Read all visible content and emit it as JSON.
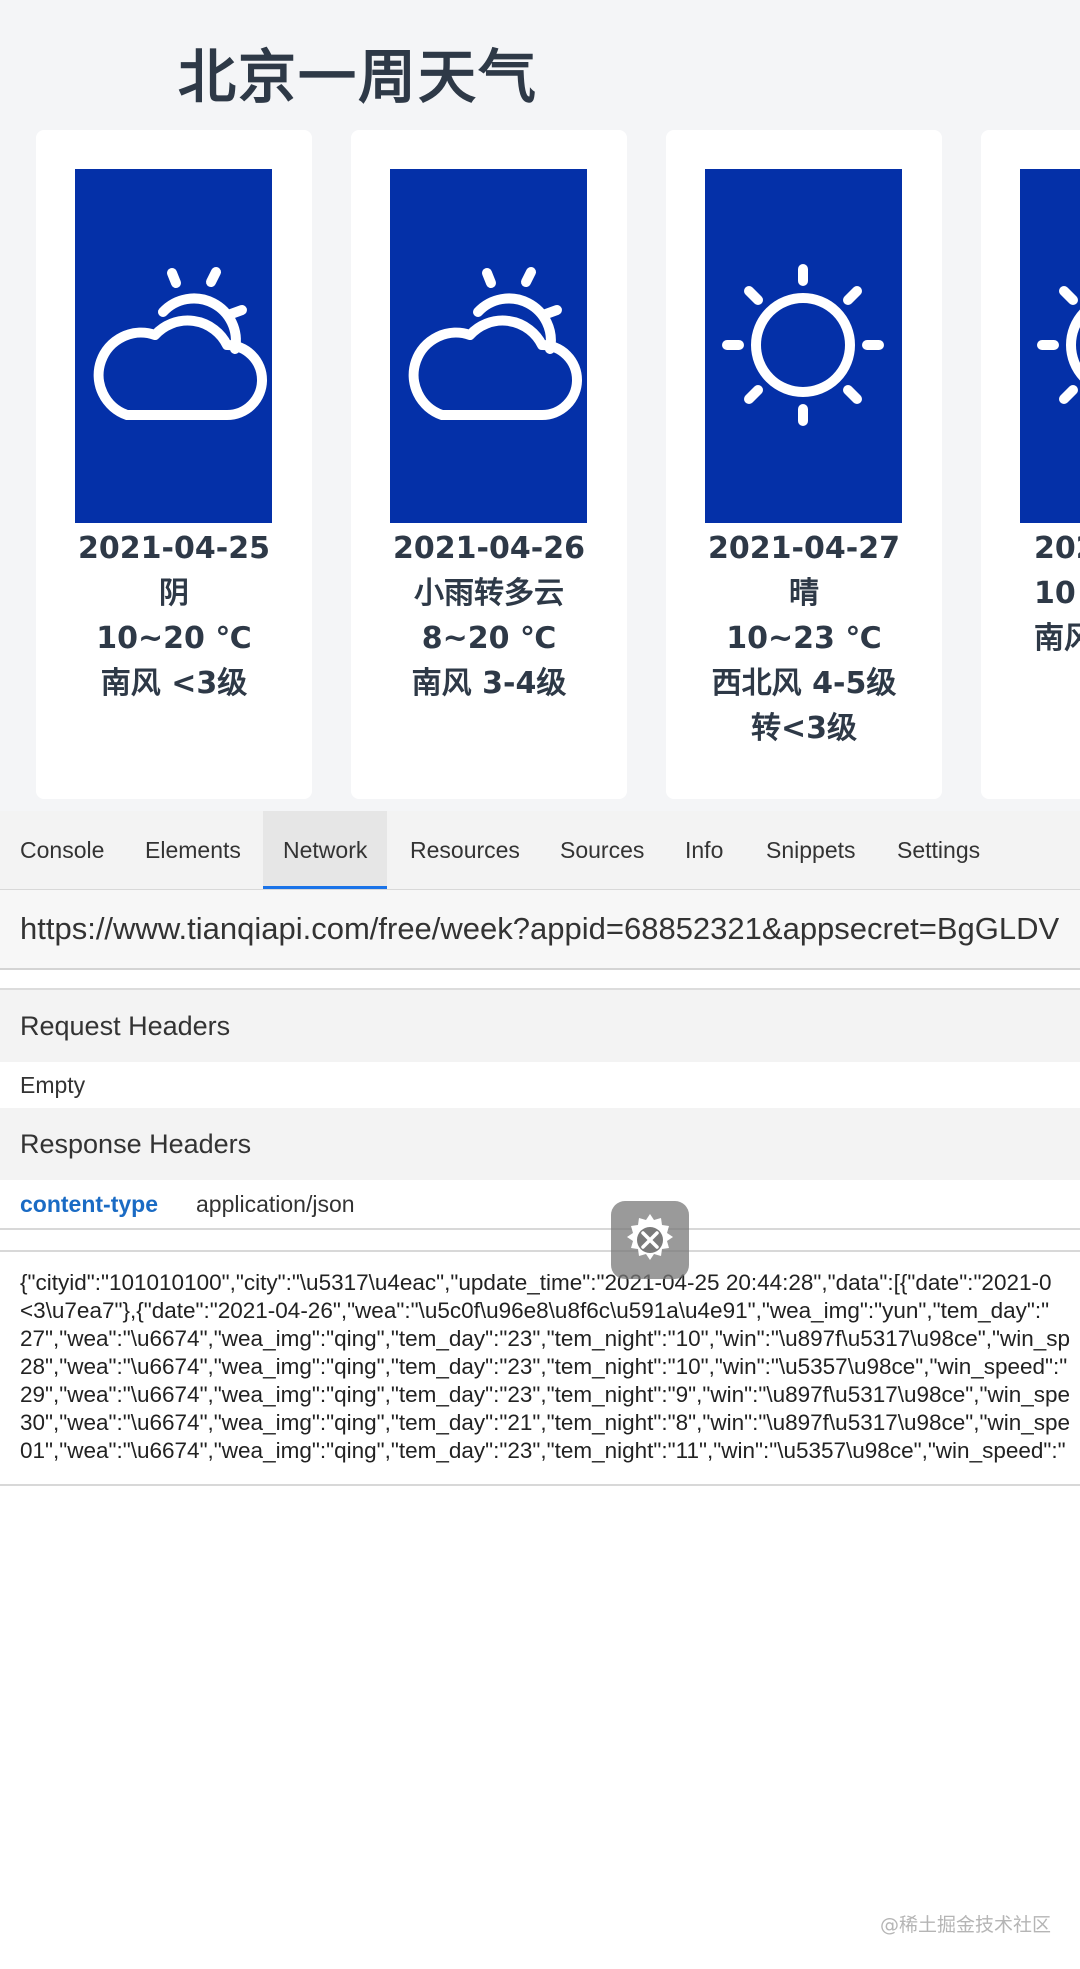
{
  "title": "北京一周天气",
  "colors": {
    "icon_bg": "#0430a8",
    "accent": "#1a73e8",
    "key": "#1a6bc4"
  },
  "cards": [
    {
      "date": "2021-04-25",
      "weather": "阴",
      "temp": "10~20 ℃",
      "wind": "南风 <3级",
      "wind2": "",
      "icon": "cloud-sun-icon"
    },
    {
      "date": "2021-04-26",
      "weather": "小雨转多云",
      "temp": "8~20 ℃",
      "wind": "南风 3-4级",
      "wind2": "",
      "icon": "cloud-sun-icon"
    },
    {
      "date": "2021-04-27",
      "weather": "晴",
      "temp": "10~23 ℃",
      "wind": "西北风 4-5级",
      "wind2": "转<3级",
      "icon": "sun-icon"
    },
    {
      "date": "202",
      "weather": "",
      "temp": "10",
      "wind": "南风",
      "wind2": "",
      "icon": "sun-icon"
    }
  ],
  "devtools": {
    "tabs": [
      "Console",
      "Elements",
      "Network",
      "Resources",
      "Sources",
      "Info",
      "Snippets",
      "Settings"
    ],
    "active_tab": "Network",
    "url": "https://www.tianqiapi.com/free/week?appid=68852321&appsecret=BgGLDV",
    "request_headers_label": "Request Headers",
    "request_headers_value": "Empty",
    "response_headers_label": "Response Headers",
    "response_header_key": "content-type",
    "response_header_value": "application/json",
    "response_body_lines": [
      "{\"cityid\":\"101010100\",\"city\":\"\\u5317\\u4eac\",\"update_time\":\"2021-04-25 20:44:28\",\"data\":[{\"date\":\"2021-0",
      "<3\\u7ea7\"},{\"date\":\"2021-04-26\",\"wea\":\"\\u5c0f\\u96e8\\u8f6c\\u591a\\u4e91\",\"wea_img\":\"yun\",\"tem_day\":\"",
      "27\",\"wea\":\"\\u6674\",\"wea_img\":\"qing\",\"tem_day\":\"23\",\"tem_night\":\"10\",\"win\":\"\\u897f\\u5317\\u98ce\",\"win_sp",
      "28\",\"wea\":\"\\u6674\",\"wea_img\":\"qing\",\"tem_day\":\"23\",\"tem_night\":\"10\",\"win\":\"\\u5357\\u98ce\",\"win_speed\":\"",
      "29\",\"wea\":\"\\u6674\",\"wea_img\":\"qing\",\"tem_day\":\"23\",\"tem_night\":\"9\",\"win\":\"\\u897f\\u5317\\u98ce\",\"win_spe",
      "30\",\"wea\":\"\\u6674\",\"wea_img\":\"qing\",\"tem_day\":\"21\",\"tem_night\":\"8\",\"win\":\"\\u897f\\u5317\\u98ce\",\"win_spe",
      "01\",\"wea\":\"\\u6674\",\"wea_img\":\"qing\",\"tem_day\":\"23\",\"tem_night\":\"11\",\"win\":\"\\u5357\\u98ce\",\"win_speed\":\""
    ]
  },
  "floating_button_icon": "tools-gear-icon",
  "watermark": "@稀土掘金技术社区"
}
